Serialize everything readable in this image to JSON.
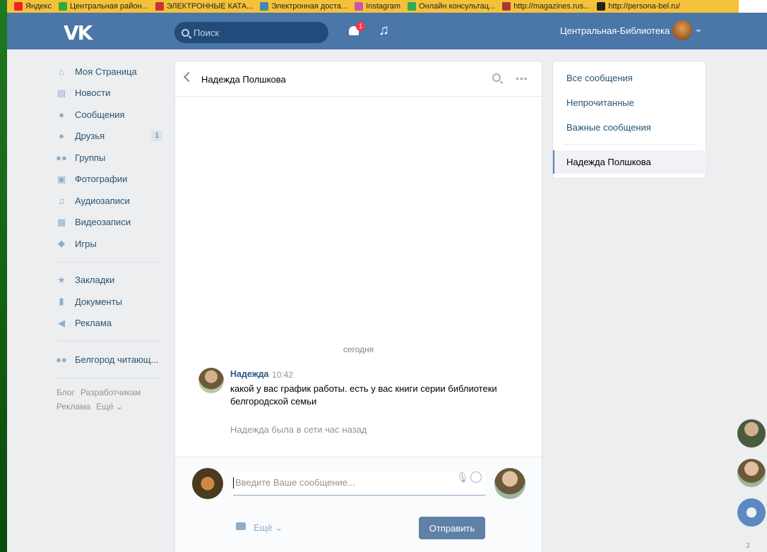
{
  "bookmarks": [
    {
      "label": "Яндекс",
      "color": "#e22"
    },
    {
      "label": "Центральная район...",
      "color": "#3a3"
    },
    {
      "label": "ЭЛЕКТРОННЫЕ КАТА...",
      "color": "#c33"
    },
    {
      "label": "Электронная доста...",
      "color": "#48a"
    },
    {
      "label": "Instagram",
      "color": "#c5a"
    },
    {
      "label": "Онлайн консультац...",
      "color": "#3a5"
    },
    {
      "label": "http://magazines.rus...",
      "color": "#a33"
    },
    {
      "label": "http://persona-bel.ru/",
      "color": "#222"
    }
  ],
  "header": {
    "search_placeholder": "Поиск",
    "notification_count": "1",
    "profile_name": "Центральная-Библиотека"
  },
  "sidebar": {
    "items": [
      {
        "label": "Моя Страница",
        "icon": "home-icon",
        "glyph": "⌂"
      },
      {
        "label": "Новости",
        "icon": "news-icon",
        "glyph": "▤"
      },
      {
        "label": "Сообщения",
        "icon": "messages-icon",
        "glyph": "●"
      },
      {
        "label": "Друзья",
        "icon": "friends-icon",
        "glyph": "●",
        "badge": "1"
      },
      {
        "label": "Группы",
        "icon": "groups-icon",
        "glyph": "●●"
      },
      {
        "label": "Фотографии",
        "icon": "camera-icon",
        "glyph": "▣"
      },
      {
        "label": "Аудиозаписи",
        "icon": "music-icon",
        "glyph": "♫"
      },
      {
        "label": "Видеозаписи",
        "icon": "video-icon",
        "glyph": "▦"
      },
      {
        "label": "Игры",
        "icon": "games-icon",
        "glyph": "◆"
      }
    ],
    "items2": [
      {
        "label": "Закладки",
        "icon": "star-icon",
        "glyph": "★"
      },
      {
        "label": "Документы",
        "icon": "document-icon",
        "glyph": "▮"
      },
      {
        "label": "Реклама",
        "icon": "megaphone-icon",
        "glyph": "◀"
      }
    ],
    "items3": [
      {
        "label": "Белгород читающ...",
        "icon": "group-icon",
        "glyph": "●●"
      }
    ],
    "footer": {
      "blog": "Блог",
      "developers": "Разработчикам",
      "ads": "Реклама",
      "more": "Ещё ⌄"
    }
  },
  "chat": {
    "title": "Надежда Полшкова",
    "date_separator": "сегодня",
    "message": {
      "author": "Надежда",
      "time": "10:42",
      "text": "какой у вас график работы. есть у вас книги серии библиотеки белгородской семьи"
    },
    "online_note": "Надежда была в сети час назад",
    "composer": {
      "placeholder": "Введите Ваше сообщение...",
      "more_label": "Ещё ⌄",
      "send_label": "Отправить"
    }
  },
  "filters": {
    "all": "Все сообщения",
    "unread": "Непрочитанные",
    "important": "Важные сообщения",
    "active_chat": "Надежда Полшкова"
  },
  "edge": {
    "count": "3"
  },
  "colors": {
    "header": "#4a76a8",
    "link": "#285473",
    "accent": "#5181b8",
    "send_button": "#5e81a8",
    "badge": "#ff3347"
  }
}
